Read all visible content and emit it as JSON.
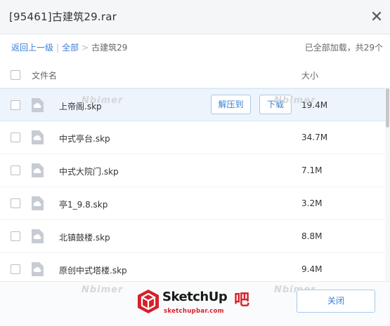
{
  "dialog": {
    "title": "[95461]古建筑29.rar",
    "close_icon": "close-x-icon"
  },
  "breadcrumb": {
    "back": "返回上一级",
    "separator1": "|",
    "all": "全部",
    "separator2": ">",
    "current": "古建筑29"
  },
  "status": {
    "loaded_text": "已全部加载，共29个"
  },
  "columns": {
    "name": "文件名",
    "size": "大小"
  },
  "files": [
    {
      "name": "上帝阁.skp",
      "size": "19.4M",
      "icon": "file-cloud-icon"
    },
    {
      "name": "中式亭台.skp",
      "size": "34.7M",
      "icon": "file-cloud-icon"
    },
    {
      "name": "中式大院门.skp",
      "size": "7.1M",
      "icon": "file-cloud-icon"
    },
    {
      "name": "亭1_9.8.skp",
      "size": "3.2M",
      "icon": "file-cloud-icon"
    },
    {
      "name": "北镇鼓楼.skp",
      "size": "8.8M",
      "icon": "file-cloud-icon"
    },
    {
      "name": "原创中式塔楼.skp",
      "size": "9.4M",
      "icon": "file-cloud-icon"
    }
  ],
  "row_actions": {
    "extract": "解压到",
    "download": "下载"
  },
  "watermark": {
    "text": "Nbimer"
  },
  "logo": {
    "brand": "SketchUp",
    "accent": "吧",
    "site": "sketchupbar.com"
  },
  "footer": {
    "close_label": "关闭"
  },
  "colors": {
    "accent": "#3a7fd5",
    "logo_red": "#d6202a",
    "icon_gray": "#c7ccd3"
  }
}
